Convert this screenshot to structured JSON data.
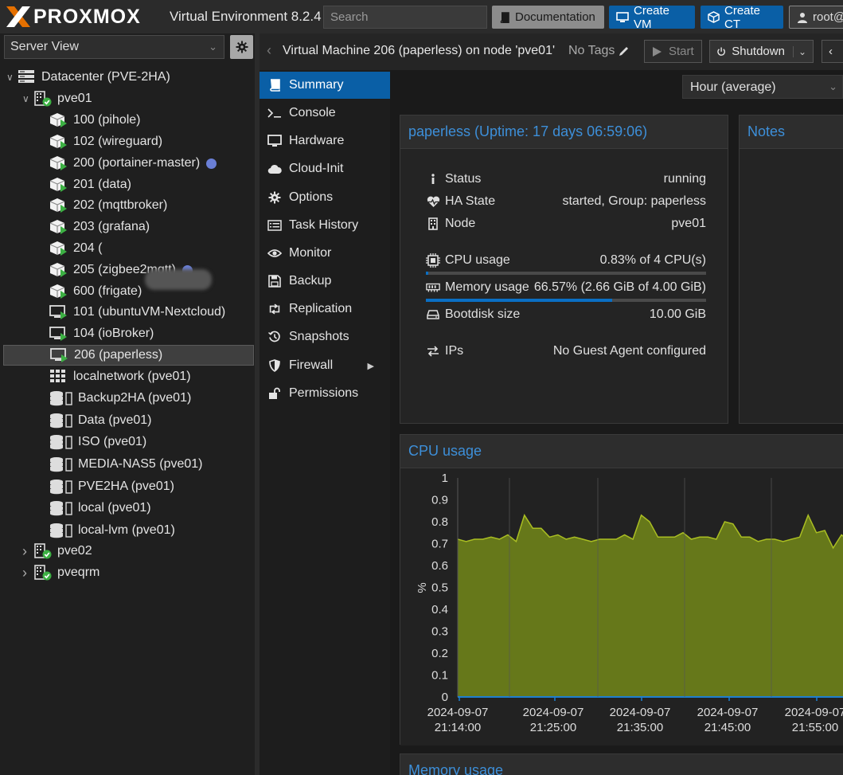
{
  "header": {
    "logo_text_x": "X",
    "logo_text_rest": "PROXMOX",
    "subtitle": "Virtual Environment 8.2.4",
    "search_placeholder": "Search",
    "documentation": "Documentation",
    "create_vm": "Create VM",
    "create_ct": "Create CT",
    "user": "root@"
  },
  "left": {
    "view": "Server View",
    "tree": [
      {
        "label": "Datacenter (PVE-2HA)",
        "type": "datacenter",
        "depth": 0,
        "toggle": "open"
      },
      {
        "label": "pve01",
        "type": "node",
        "depth": 1,
        "toggle": "open"
      },
      {
        "label": "100 (pihole)",
        "type": "ct",
        "depth": 2
      },
      {
        "label": "102 (wireguard)",
        "type": "ct",
        "depth": 2
      },
      {
        "label": "200 (portainer-master)",
        "type": "ct",
        "depth": 2,
        "dot": true
      },
      {
        "label": "201 (data)",
        "type": "ct",
        "depth": 2
      },
      {
        "label": "202 (mqttbroker)",
        "type": "ct",
        "depth": 2
      },
      {
        "label": "203 (grafana)",
        "type": "ct",
        "depth": 2
      },
      {
        "label": "204 (",
        "type": "ct",
        "depth": 2
      },
      {
        "label": "205 (zigbee2mqtt)",
        "type": "ct",
        "depth": 2,
        "dot": true
      },
      {
        "label": "600 (frigate)",
        "type": "ct",
        "depth": 2
      },
      {
        "label": "101 (ubuntuVM-Nextcloud)",
        "type": "vm",
        "depth": 2
      },
      {
        "label": "104 (ioBroker)",
        "type": "vm",
        "depth": 2
      },
      {
        "label": "206 (paperless)",
        "type": "vm",
        "depth": 2,
        "selected": true
      },
      {
        "label": "localnetwork (pve01)",
        "type": "network",
        "depth": 2
      },
      {
        "label": "Backup2HA (pve01)",
        "type": "storage",
        "depth": 2
      },
      {
        "label": "Data (pve01)",
        "type": "storage",
        "depth": 2
      },
      {
        "label": "ISO (pve01)",
        "type": "storage",
        "depth": 2
      },
      {
        "label": "MEDIA-NAS5 (pve01)",
        "type": "storage",
        "depth": 2
      },
      {
        "label": "PVE2HA (pve01)",
        "type": "storage",
        "depth": 2
      },
      {
        "label": "local (pve01)",
        "type": "storage",
        "depth": 2
      },
      {
        "label": "local-lvm (pve01)",
        "type": "storage",
        "depth": 2
      },
      {
        "label": "pve02",
        "type": "node",
        "depth": 1,
        "toggle": "closed"
      },
      {
        "label": "pveqrm",
        "type": "node",
        "depth": 1,
        "toggle": "closed"
      }
    ]
  },
  "toolbar": {
    "title": "Virtual Machine 206 (paperless) on node 'pve01'",
    "tags": "No Tags",
    "start": "Start",
    "shutdown": "Shutdown"
  },
  "menu": [
    {
      "label": "Summary",
      "icon": "book-icon",
      "active": true
    },
    {
      "label": "Console",
      "icon": "terminal-icon"
    },
    {
      "label": "Hardware",
      "icon": "monitor-icon"
    },
    {
      "label": "Cloud-Init",
      "icon": "cloud-icon"
    },
    {
      "label": "Options",
      "icon": "gear-icon"
    },
    {
      "label": "Task History",
      "icon": "list-icon"
    },
    {
      "label": "Monitor",
      "icon": "eye-icon"
    },
    {
      "label": "Backup",
      "icon": "floppy-icon"
    },
    {
      "label": "Replication",
      "icon": "retweet-icon"
    },
    {
      "label": "Snapshots",
      "icon": "history-icon"
    },
    {
      "label": "Firewall",
      "icon": "shield-icon",
      "submenu": true
    },
    {
      "label": "Permissions",
      "icon": "unlock-icon"
    }
  ],
  "summary": {
    "timeframe": "Hour (average)",
    "status_title": "paperless (Uptime: 17 days 06:59:06)",
    "notes_title": "Notes",
    "rows": {
      "status_label": "Status",
      "status_value": "running",
      "ha_label": "HA State",
      "ha_value": "started, Group: paperless",
      "node_label": "Node",
      "node_value": "pve01",
      "cpu_label": "CPU usage",
      "cpu_value": "0.83% of 4 CPU(s)",
      "mem_label": "Memory usage",
      "mem_value": "66.57% (2.66 GiB of 4.00 GiB)",
      "disk_label": "Bootdisk size",
      "disk_value": "10.00 GiB",
      "ips_label": "IPs",
      "ips_value": "No Guest Agent configured"
    },
    "cpu_fraction": 0.0083,
    "mem_fraction": 0.6657
  },
  "cpu_chart_title": "CPU usage",
  "mem_chart_title": "Memory usage",
  "colors": {
    "accent": "#0a5fa6",
    "link": "#3d8fd9",
    "area_fill": "#66781a",
    "area_line": "#aabe22",
    "running": "#3cb043"
  },
  "chart_data": {
    "type": "area",
    "title": "CPU usage",
    "ylabel": "%",
    "ylim": [
      0,
      1
    ],
    "yticks": [
      "0",
      "0.1",
      "0.2",
      "0.3",
      "0.4",
      "0.5",
      "0.6",
      "0.7",
      "0.8",
      "0.9",
      "1"
    ],
    "xticks": [
      {
        "date": "2024-09-07",
        "time": "21:14:00"
      },
      {
        "date": "2024-09-07",
        "time": "21:25:00"
      },
      {
        "date": "2024-09-07",
        "time": "21:35:00"
      },
      {
        "date": "2024-09-07",
        "time": "21:45:00"
      },
      {
        "date": "2024-09-07",
        "time": "21:55:00"
      }
    ],
    "series": [
      {
        "values": [
          0.72,
          0.71,
          0.72,
          0.72,
          0.73,
          0.72,
          0.74,
          0.71,
          0.83,
          0.77,
          0.77,
          0.73,
          0.74,
          0.72,
          0.73,
          0.72,
          0.71,
          0.72,
          0.72,
          0.72,
          0.74,
          0.72,
          0.83,
          0.8,
          0.73,
          0.73,
          0.73,
          0.75,
          0.72,
          0.73,
          0.73,
          0.72,
          0.8,
          0.79,
          0.73,
          0.73,
          0.71,
          0.72,
          0.72,
          0.71,
          0.72,
          0.73,
          0.83,
          0.75,
          0.76,
          0.68,
          0.74,
          0.71,
          0.73,
          0.72,
          0.72
        ]
      }
    ]
  }
}
